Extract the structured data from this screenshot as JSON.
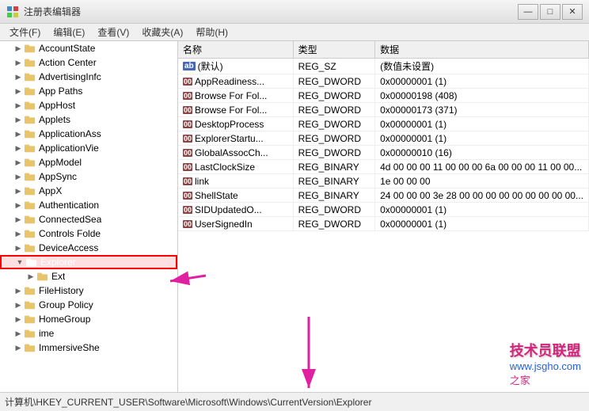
{
  "window": {
    "title": "注册表编辑器",
    "icon": "regedit"
  },
  "titleButtons": {
    "minimize": "—",
    "maximize": "□",
    "close": "✕"
  },
  "menuBar": {
    "items": [
      {
        "label": "文件(F)"
      },
      {
        "label": "编辑(E)"
      },
      {
        "label": "查看(V)"
      },
      {
        "label": "收藏夹(A)"
      },
      {
        "label": "帮助(H)"
      }
    ]
  },
  "treeItems": [
    {
      "label": "AccountState",
      "indent": 1,
      "expanded": false,
      "selected": false
    },
    {
      "label": "Action Center",
      "indent": 1,
      "expanded": false,
      "selected": false
    },
    {
      "label": "AdvertisingInfc",
      "indent": 1,
      "expanded": false,
      "selected": false
    },
    {
      "label": "App Paths",
      "indent": 1,
      "expanded": false,
      "selected": false
    },
    {
      "label": "AppHost",
      "indent": 1,
      "expanded": false,
      "selected": false
    },
    {
      "label": "Applets",
      "indent": 1,
      "expanded": false,
      "selected": false
    },
    {
      "label": "ApplicationAss",
      "indent": 1,
      "expanded": false,
      "selected": false
    },
    {
      "label": "ApplicationVie",
      "indent": 1,
      "expanded": false,
      "selected": false
    },
    {
      "label": "AppModel",
      "indent": 1,
      "expanded": false,
      "selected": false
    },
    {
      "label": "AppSync",
      "indent": 1,
      "expanded": false,
      "selected": false
    },
    {
      "label": "AppX",
      "indent": 1,
      "expanded": false,
      "selected": false
    },
    {
      "label": "Authentication",
      "indent": 1,
      "expanded": false,
      "selected": false
    },
    {
      "label": "ConnectedSea",
      "indent": 1,
      "expanded": false,
      "selected": false
    },
    {
      "label": "Controls Folde",
      "indent": 1,
      "expanded": false,
      "selected": false
    },
    {
      "label": "DeviceAccess",
      "indent": 1,
      "expanded": false,
      "selected": false
    },
    {
      "label": "Explorer",
      "indent": 1,
      "expanded": true,
      "selected": true,
      "highlighted": true
    },
    {
      "label": "Ext",
      "indent": 2,
      "expanded": false,
      "selected": false
    },
    {
      "label": "FileHistory",
      "indent": 1,
      "expanded": false,
      "selected": false
    },
    {
      "label": "Group Policy",
      "indent": 1,
      "expanded": false,
      "selected": false
    },
    {
      "label": "HomeGroup",
      "indent": 1,
      "expanded": false,
      "selected": false
    },
    {
      "label": "ime",
      "indent": 1,
      "expanded": false,
      "selected": false
    },
    {
      "label": "ImmersiveShe",
      "indent": 1,
      "expanded": false,
      "selected": false
    }
  ],
  "tableHeaders": [
    "名称",
    "类型",
    "数据"
  ],
  "tableRows": [
    {
      "name": "(默认)",
      "type": "REG_SZ",
      "data": "(数值未设置)",
      "icon": "ab"
    },
    {
      "name": "AppReadiness...",
      "type": "REG_DWORD",
      "data": "0x00000001 (1)",
      "icon": "dword"
    },
    {
      "name": "Browse For Fol...",
      "type": "REG_DWORD",
      "data": "0x00000198 (408)",
      "icon": "dword"
    },
    {
      "name": "Browse For Fol...",
      "type": "REG_DWORD",
      "data": "0x00000173 (371)",
      "icon": "dword"
    },
    {
      "name": "DesktopProcess",
      "type": "REG_DWORD",
      "data": "0x00000001 (1)",
      "icon": "dword"
    },
    {
      "name": "ExplorerStartu...",
      "type": "REG_DWORD",
      "data": "0x00000001 (1)",
      "icon": "dword"
    },
    {
      "name": "GlobalAssocCh...",
      "type": "REG_DWORD",
      "data": "0x00000010 (16)",
      "icon": "dword"
    },
    {
      "name": "LastClockSize",
      "type": "REG_BINARY",
      "data": "4d 00 00 00 11 00 00 00 6a 00 00 00 11 00 00...",
      "icon": "binary"
    },
    {
      "name": "link",
      "type": "REG_BINARY",
      "data": "1e 00 00 00",
      "icon": "binary"
    },
    {
      "name": "ShellState",
      "type": "REG_BINARY",
      "data": "24 00 00 00 3e 28 00 00 00 00 00 00 00 00 00...",
      "icon": "binary"
    },
    {
      "name": "SIDUpdatedO...",
      "type": "REG_DWORD",
      "data": "0x00000001 (1)",
      "icon": "dword"
    },
    {
      "name": "UserSignedIn",
      "type": "REG_DWORD",
      "data": "0x00000001 (1)",
      "icon": "dword"
    }
  ],
  "statusBar": {
    "path": "计算机\\HKEY_CURRENT_USER\\Software\\Microsoft\\Windows\\CurrentVersion\\Explorer"
  }
}
